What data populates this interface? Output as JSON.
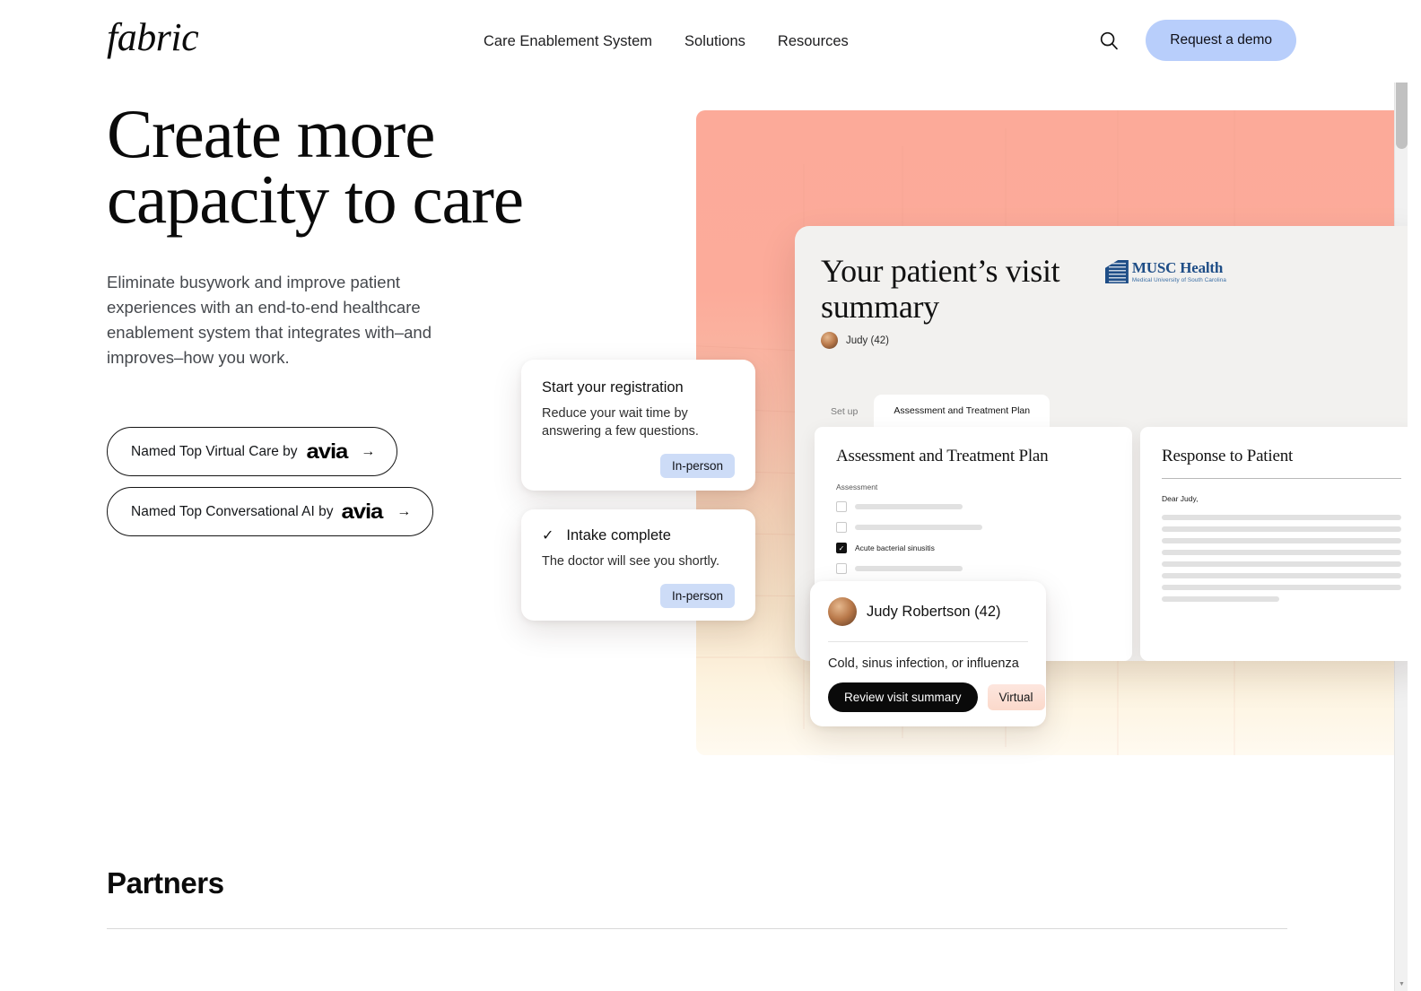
{
  "header": {
    "logo": "fabric",
    "nav": [
      {
        "label": "Care Enablement System"
      },
      {
        "label": "Solutions"
      },
      {
        "label": "Resources"
      }
    ],
    "search_icon": "search-icon",
    "demo_label": "Request a demo",
    "demo_bg": "#b8cefb"
  },
  "hero": {
    "title": "Create more\ncapacity to care",
    "subtitle": "Eliminate busywork and improve patient experiences with an end-to-end healthcare enablement system that integrates with–and improves–how you work.",
    "awards": [
      {
        "text": "Named Top Virtual Care by",
        "brand": "avia",
        "arrow": "→"
      },
      {
        "text": "Named Top Conversational AI by",
        "brand": "avia",
        "arrow": "→"
      }
    ],
    "gradient_top": "#fcaa99",
    "gradient_bottom": "#fffaf0"
  },
  "visit_panel": {
    "title": "Your patient’s visit\nsummary",
    "brand": {
      "name": "MUSC Health",
      "tagline": "Medical University of South Carolina",
      "color": "#1f4e87"
    },
    "patient": "Judy (42)",
    "tabs": [
      {
        "label": "Set up",
        "active": false
      },
      {
        "label": "Assessment and Treatment Plan",
        "active": true
      }
    ],
    "assessment": {
      "heading": "Assessment and Treatment Plan",
      "section_label": "Assessment",
      "items": [
        {
          "checked": false,
          "text": "",
          "bar_width": "50%"
        },
        {
          "checked": false,
          "text": "",
          "bar_width": "59%"
        },
        {
          "checked": true,
          "text": "Acute bacterial sinusitis",
          "bar_width": "0"
        },
        {
          "checked": false,
          "text": "",
          "bar_width": "50%"
        }
      ]
    },
    "response": {
      "heading": "Response to Patient",
      "greeting": "Dear Judy,",
      "line_widths": [
        "100%",
        "100%",
        "100%",
        "100%",
        "100%",
        "100%",
        "100%",
        "49%"
      ]
    }
  },
  "float_cards": {
    "registration": {
      "title": "Start your registration",
      "body": "Reduce your wait time by answering a few questions.",
      "badge": "In-person",
      "badge_color": "#cddcf7"
    },
    "intake": {
      "check_icon": "check-icon",
      "title": "Intake complete",
      "body": "The doctor will see you shortly.",
      "badge": "In-person",
      "badge_color": "#cddcf7"
    },
    "judy": {
      "name": "Judy Robertson (42)",
      "condition": "Cold, sinus infection, or influenza",
      "primary_action": "Review visit summary",
      "badge": "Virtual",
      "badge_color": "#fbd9cb"
    }
  },
  "partners": {
    "heading": "Partners"
  }
}
